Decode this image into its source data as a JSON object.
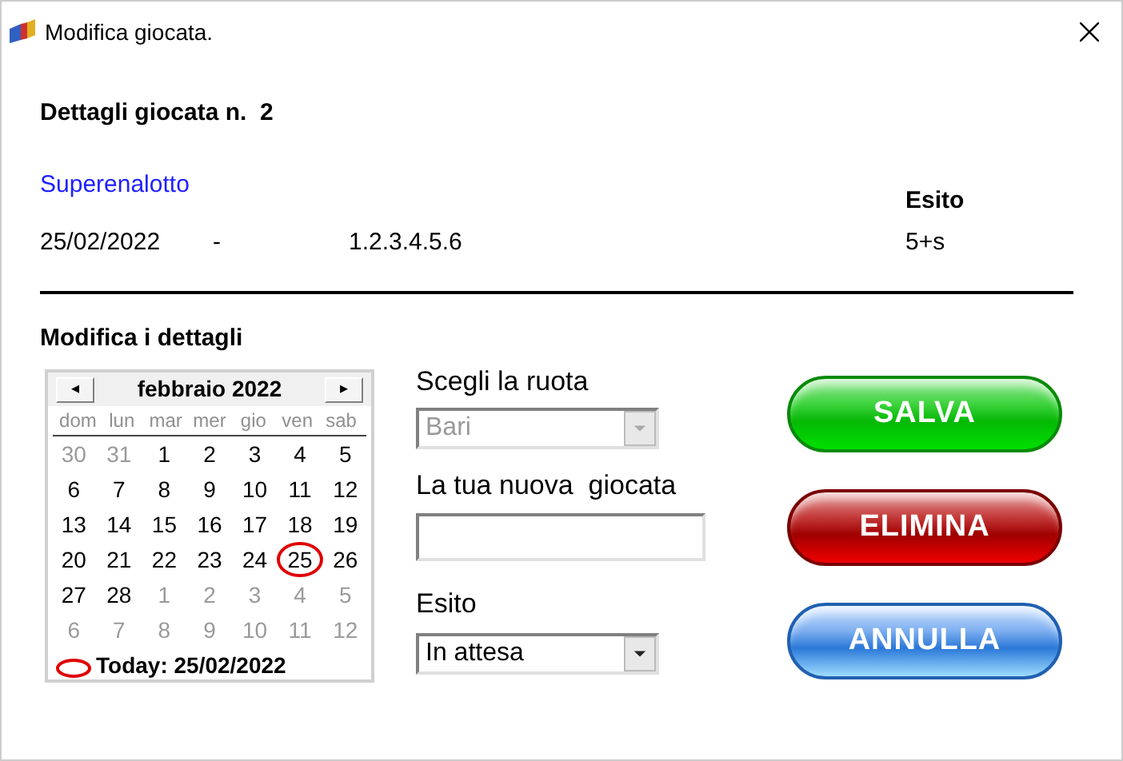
{
  "window": {
    "title": "Modifica giocata."
  },
  "details": {
    "heading": "Dettagli giocata n.  2",
    "game": "Superenalotto",
    "date": "25/02/2022",
    "separator": "-",
    "numbers": "1.2.3.4.5.6",
    "result_label": "Esito",
    "result": "5+s"
  },
  "edit": {
    "heading": "Modifica i dettagli",
    "calendar": {
      "prev": "◂",
      "month": "febbraio 2022",
      "next": "▸",
      "weekdays": [
        "dom",
        "lun",
        "mar",
        "mer",
        "gio",
        "ven",
        "sab"
      ],
      "days": [
        {
          "label": "30",
          "muted": true,
          "selected": false
        },
        {
          "label": "31",
          "muted": true,
          "selected": false
        },
        {
          "label": "1",
          "muted": false,
          "selected": false
        },
        {
          "label": "2",
          "muted": false,
          "selected": false
        },
        {
          "label": "3",
          "muted": false,
          "selected": false
        },
        {
          "label": "4",
          "muted": false,
          "selected": false
        },
        {
          "label": "5",
          "muted": false,
          "selected": false
        },
        {
          "label": "6",
          "muted": false,
          "selected": false
        },
        {
          "label": "7",
          "muted": false,
          "selected": false
        },
        {
          "label": "8",
          "muted": false,
          "selected": false
        },
        {
          "label": "9",
          "muted": false,
          "selected": false
        },
        {
          "label": "10",
          "muted": false,
          "selected": false
        },
        {
          "label": "11",
          "muted": false,
          "selected": false
        },
        {
          "label": "12",
          "muted": false,
          "selected": false
        },
        {
          "label": "13",
          "muted": false,
          "selected": false
        },
        {
          "label": "14",
          "muted": false,
          "selected": false
        },
        {
          "label": "15",
          "muted": false,
          "selected": false
        },
        {
          "label": "16",
          "muted": false,
          "selected": false
        },
        {
          "label": "17",
          "muted": false,
          "selected": false
        },
        {
          "label": "18",
          "muted": false,
          "selected": false
        },
        {
          "label": "19",
          "muted": false,
          "selected": false
        },
        {
          "label": "20",
          "muted": false,
          "selected": false
        },
        {
          "label": "21",
          "muted": false,
          "selected": false
        },
        {
          "label": "22",
          "muted": false,
          "selected": false
        },
        {
          "label": "23",
          "muted": false,
          "selected": false
        },
        {
          "label": "24",
          "muted": false,
          "selected": false
        },
        {
          "label": "25",
          "muted": false,
          "selected": true
        },
        {
          "label": "26",
          "muted": false,
          "selected": false
        },
        {
          "label": "27",
          "muted": false,
          "selected": false
        },
        {
          "label": "28",
          "muted": false,
          "selected": false
        },
        {
          "label": "1",
          "muted": true,
          "selected": false
        },
        {
          "label": "2",
          "muted": true,
          "selected": false
        },
        {
          "label": "3",
          "muted": true,
          "selected": false
        },
        {
          "label": "4",
          "muted": true,
          "selected": false
        },
        {
          "label": "5",
          "muted": true,
          "selected": false
        },
        {
          "label": "6",
          "muted": true,
          "selected": false
        },
        {
          "label": "7",
          "muted": true,
          "selected": false
        },
        {
          "label": "8",
          "muted": true,
          "selected": false
        },
        {
          "label": "9",
          "muted": true,
          "selected": false
        },
        {
          "label": "10",
          "muted": true,
          "selected": false
        },
        {
          "label": "11",
          "muted": true,
          "selected": false
        },
        {
          "label": "12",
          "muted": true,
          "selected": false
        }
      ],
      "today": "Today: 25/02/2022"
    },
    "wheel_label": "Scegli la ruota",
    "wheel": {
      "value": "Bari",
      "disabled": true
    },
    "new_play_label": "La tua nuova  giocata",
    "result_label": "Esito",
    "result": {
      "value": "In attesa",
      "disabled": false
    }
  },
  "buttons": [
    {
      "label": "SALVA",
      "kind": "green"
    },
    {
      "label": "ELIMINA",
      "kind": "red"
    },
    {
      "label": "ANNULLA",
      "kind": "blue"
    }
  ]
}
